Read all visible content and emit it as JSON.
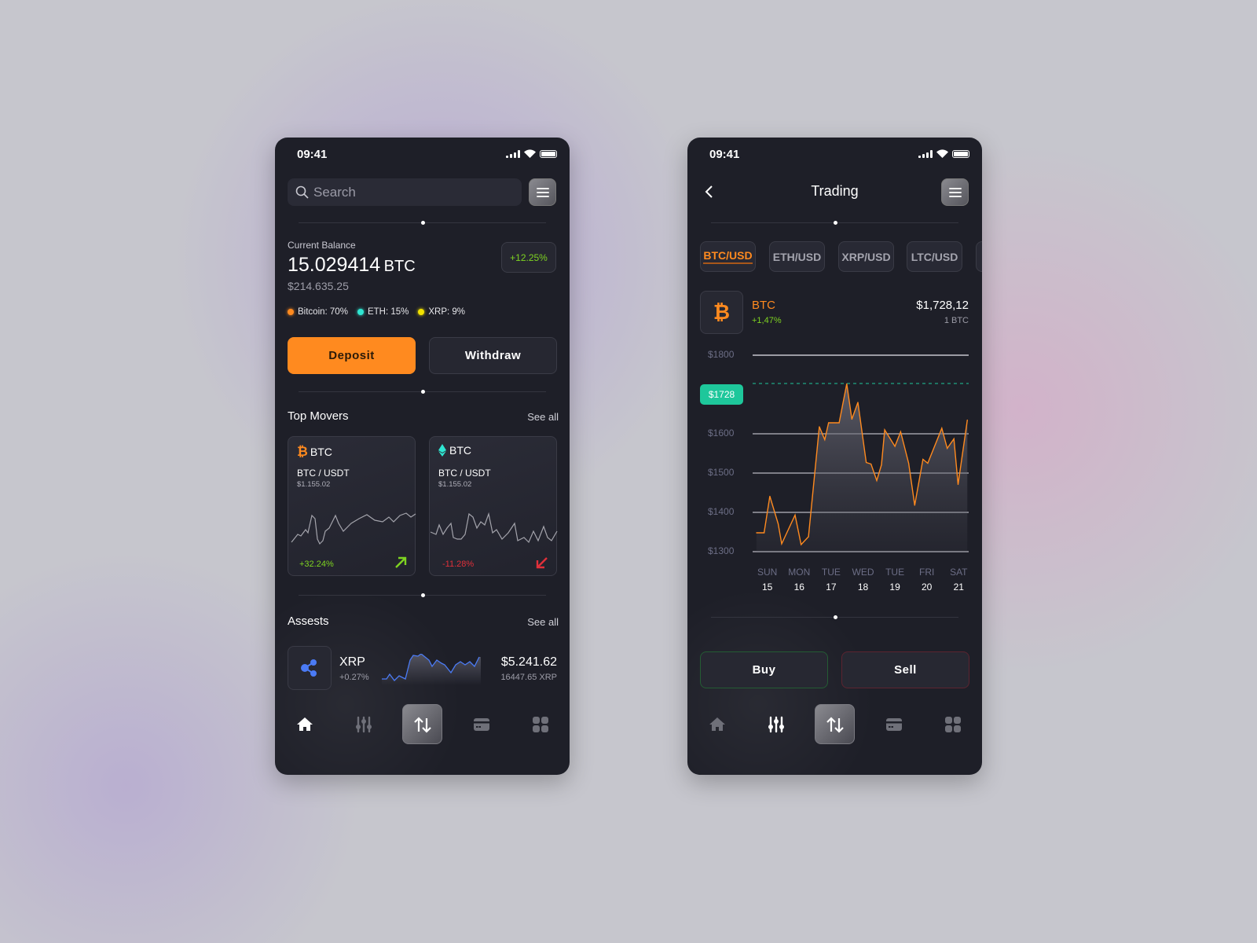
{
  "status_bar": {
    "time": "09:41"
  },
  "colors": {
    "accent": "#ff8a1f",
    "positive": "#7ed321",
    "negative": "#e0303a",
    "teal": "#1ec79b",
    "eth": "#2fe6d2",
    "xrp": "#f2e200",
    "xrp_icon": "#4b7bf5"
  },
  "home": {
    "search": {
      "placeholder": "Search",
      "icon": "search-icon"
    },
    "menu_icon": "menu-icon",
    "balance": {
      "label": "Current Balance",
      "amount": "15.029414",
      "unit": "BTC",
      "usd": "$214.635.25",
      "change": "+12.25%"
    },
    "allocation": [
      {
        "label": "Bitcoin: 70%",
        "color": "#ff8a1f"
      },
      {
        "label": "ETH: 15%",
        "color": "#2fe6d2"
      },
      {
        "label": "XRP: 9%",
        "color": "#f2e200"
      }
    ],
    "deposit_label": "Deposit",
    "withdraw_label": "Withdraw",
    "top_movers": {
      "title": "Top Movers",
      "see_all": "See all",
      "cards": [
        {
          "icon": "bitcoin-icon",
          "coin": "BTC",
          "pair": "BTC / USDT",
          "price": "$1.155.02",
          "change": "+32.24%",
          "direction": "up"
        },
        {
          "icon": "ethereum-icon",
          "coin": "BTC",
          "pair": "BTC / USDT",
          "price": "$1.155.02",
          "change": "-11.28%",
          "direction": "down"
        }
      ]
    },
    "assets": {
      "title": "Assests",
      "see_all": "See all",
      "items": [
        {
          "icon": "ripple-icon",
          "name": "XRP",
          "change": "+0.27%",
          "value": "$5.241.62",
          "amount": "16447.65 XRP"
        }
      ]
    }
  },
  "trading": {
    "title": "Trading",
    "tabs": [
      {
        "label": "BTC/USD",
        "active": true
      },
      {
        "label": "ETH/USD"
      },
      {
        "label": "XRP/USD"
      },
      {
        "label": "LTC/USD"
      }
    ],
    "coin": {
      "icon": "bitcoin-icon",
      "name": "BTC",
      "change": "+1,47%",
      "price": "$1,728,12",
      "unit": "1 BTC"
    },
    "chart": {
      "type": "area",
      "current_price_label": "$1728",
      "current_price": 1728,
      "y_ticks": [
        "$1800",
        "$1600",
        "$1500",
        "$1400",
        "$1300"
      ],
      "ylim": [
        1300,
        1800
      ],
      "x_days": [
        {
          "day": "SUN",
          "date": "15"
        },
        {
          "day": "MON",
          "date": "16"
        },
        {
          "day": "TUE",
          "date": "17"
        },
        {
          "day": "WED",
          "date": "18"
        },
        {
          "day": "TUE",
          "date": "19"
        },
        {
          "day": "FRI",
          "date": "20"
        },
        {
          "day": "SAT",
          "date": "21"
        }
      ],
      "points": [
        [
          14.66,
          1348
        ],
        [
          14.9,
          1348
        ],
        [
          15.08,
          1441
        ],
        [
          15.34,
          1371
        ],
        [
          15.45,
          1320
        ],
        [
          15.87,
          1393
        ],
        [
          16.06,
          1318
        ],
        [
          16.29,
          1338
        ],
        [
          16.63,
          1618
        ],
        [
          16.8,
          1585
        ],
        [
          16.92,
          1628
        ],
        [
          17.25,
          1628
        ],
        [
          17.49,
          1727
        ],
        [
          17.65,
          1637
        ],
        [
          17.84,
          1680
        ],
        [
          18.1,
          1527
        ],
        [
          18.25,
          1523
        ],
        [
          18.43,
          1481
        ],
        [
          18.58,
          1521
        ],
        [
          18.68,
          1610
        ],
        [
          19.0,
          1568
        ],
        [
          19.18,
          1605
        ],
        [
          19.43,
          1525
        ],
        [
          19.62,
          1418
        ],
        [
          19.88,
          1535
        ],
        [
          20.03,
          1525
        ],
        [
          20.47,
          1614
        ],
        [
          20.64,
          1563
        ],
        [
          20.85,
          1587
        ],
        [
          20.98,
          1471
        ],
        [
          21.27,
          1635
        ]
      ]
    },
    "buy_label": "Buy",
    "sell_label": "Sell"
  },
  "nav": {
    "items": [
      {
        "icon": "home-icon"
      },
      {
        "icon": "sliders-icon"
      },
      {
        "icon": "exchange-icon"
      },
      {
        "icon": "card-icon"
      },
      {
        "icon": "grid-icon"
      }
    ]
  }
}
